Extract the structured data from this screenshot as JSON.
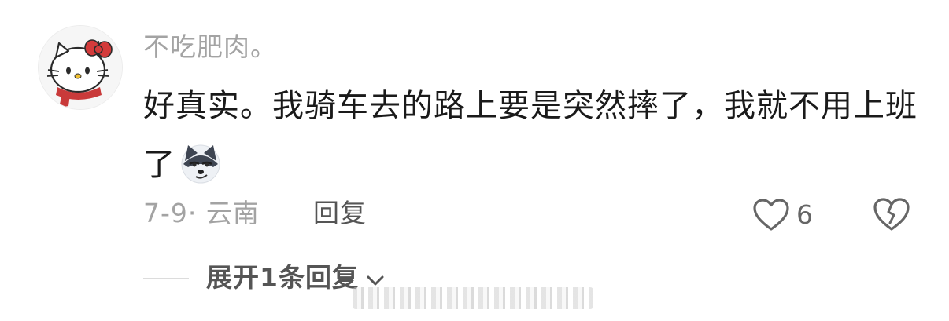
{
  "comment": {
    "avatar_icon": "hello-kitty-avatar",
    "username": "不吃肥肉。",
    "text_line": "好真实。我骑车去的路上要是突然摔了，我就不用上班了",
    "inline_emoji": "husky-smirk-emoji",
    "date_location": "7-9· 云南",
    "reply_label": "回复",
    "like_icon": "heart-outline-icon",
    "like_count": "6",
    "dislike_icon": "broken-heart-icon"
  },
  "replies": {
    "expand_label": "展开1条回复",
    "expand_icon": "chevron-down-icon"
  },
  "colors": {
    "username": "#a3a3a3",
    "comment_text": "#1a1a1a",
    "meta": "#a3a3a3",
    "action": "#555555",
    "background": "#ffffff"
  }
}
